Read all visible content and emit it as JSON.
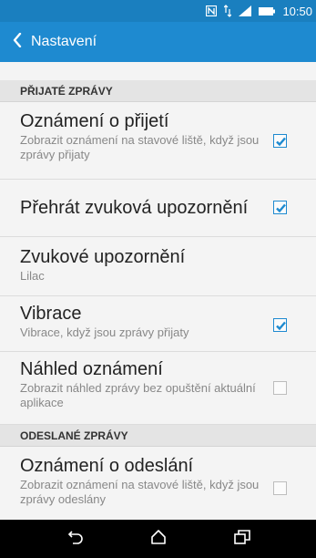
{
  "status_bar": {
    "time": "10:50",
    "icons": [
      "nfc-icon",
      "data-arrows-icon",
      "signal-icon",
      "battery-icon"
    ]
  },
  "app_bar": {
    "back_icon": "chevron-left-icon",
    "title": "Nastavení"
  },
  "sections": [
    {
      "header": "PŘIJATÉ ZPRÁVY",
      "items": [
        {
          "title": "Oznámení o přijetí",
          "subtitle": "Zobrazit oznámení na stavové liště, když jsou zprávy přijaty",
          "checked": true
        },
        {
          "title": "Přehrát zvuková upozornění",
          "checked": true
        },
        {
          "title": "Zvukové upozornění",
          "subtitle": "Lilac"
        },
        {
          "title": "Vibrace",
          "subtitle": "Vibrace, když jsou zprávy přijaty",
          "checked": true
        },
        {
          "title": "Náhled oznámení",
          "subtitle": "Zobrazit náhled zprávy bez opuštění aktuální aplikace",
          "checked": false
        }
      ]
    },
    {
      "header": "ODESLANÉ ZPRÁVY",
      "items": [
        {
          "title": "Oznámení o odeslání",
          "subtitle": "Zobrazit oznámení na stavové liště, když jsou zprávy odeslány",
          "checked": false
        }
      ]
    }
  ],
  "nav_bar": {
    "icons": [
      "back-icon",
      "home-icon",
      "recents-icon"
    ]
  },
  "colors": {
    "status_bar": "#1a7fbf",
    "app_bar": "#1e8ad0",
    "accent": "#1e8ad0",
    "section_bg": "#e4e4e4",
    "background": "#f4f4f4"
  }
}
